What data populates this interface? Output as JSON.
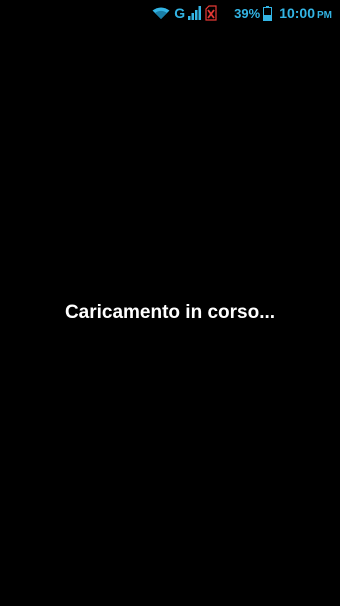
{
  "status_bar": {
    "network_type": "G",
    "battery_percent": "39%",
    "time": "10:00",
    "ampm": "PM",
    "icons": [
      "wifi-icon",
      "signal-icon",
      "no-sim-icon",
      "battery-icon"
    ],
    "accent_color": "#33b5e5",
    "alert_color": "#e53935"
  },
  "main": {
    "loading_text": "Caricamento in corso..."
  }
}
